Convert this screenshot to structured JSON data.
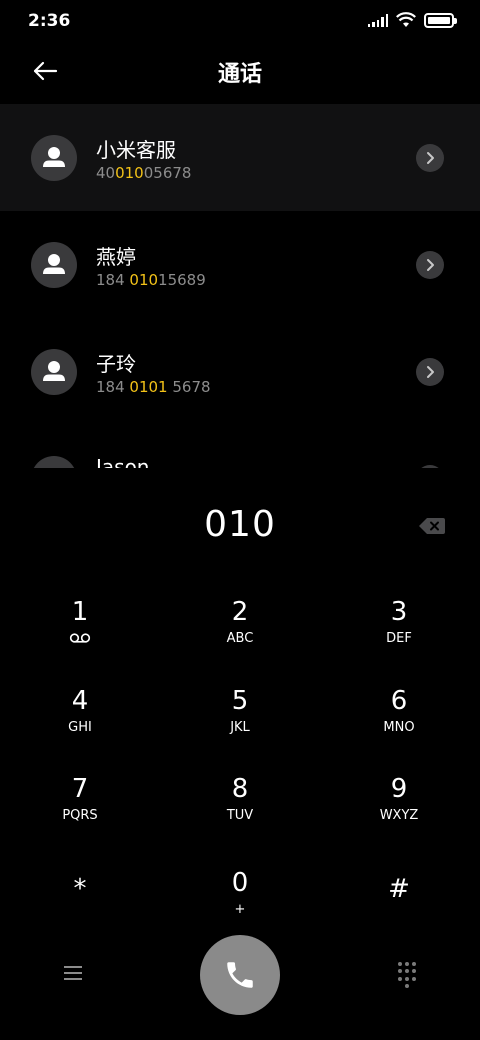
{
  "status_bar": {
    "time": "2:36",
    "icons": [
      "signal-icon",
      "wifi-icon",
      "battery-icon"
    ],
    "battery_level": 1.0
  },
  "header": {
    "title": "通话",
    "back_icon": "arrow-left-icon"
  },
  "contacts": [
    {
      "name": "小米客服",
      "number_parts": [
        "40",
        "010",
        "05678"
      ],
      "selected": true
    },
    {
      "name": "燕婷",
      "number_parts": [
        "184 ",
        "010",
        "15689"
      ],
      "selected": false
    },
    {
      "name": "子玲",
      "number_parts": [
        "184 ",
        "0101",
        " 5678"
      ],
      "selected": false
    },
    {
      "name": "Jason",
      "number_parts": [
        "",
        "",
        ""
      ],
      "selected": false
    }
  ],
  "dial": {
    "number": "010",
    "backspace_icon": "backspace-icon"
  },
  "keypad": {
    "keys": [
      {
        "digit": "1",
        "letters": "",
        "icon": "voicemail-icon"
      },
      {
        "digit": "2",
        "letters": "ABC"
      },
      {
        "digit": "3",
        "letters": "DEF"
      },
      {
        "digit": "4",
        "letters": "GHI"
      },
      {
        "digit": "5",
        "letters": "JKL"
      },
      {
        "digit": "6",
        "letters": "MNO"
      },
      {
        "digit": "7",
        "letters": "PQRS"
      },
      {
        "digit": "8",
        "letters": "TUV"
      },
      {
        "digit": "9",
        "letters": "WXYZ"
      },
      {
        "digit": "*",
        "letters": ""
      },
      {
        "digit": "0",
        "letters": "+"
      },
      {
        "digit": "#",
        "letters": ""
      }
    ]
  },
  "bottom_bar": {
    "menu_icon": "menu-icon",
    "call_icon": "phone-icon",
    "keypad_icon": "dialpad-icon"
  },
  "colors": {
    "background": "#000000",
    "highlight": "#f2c218",
    "secondary_text": "#8c8c8c",
    "call_button": "#8a8a8a"
  }
}
